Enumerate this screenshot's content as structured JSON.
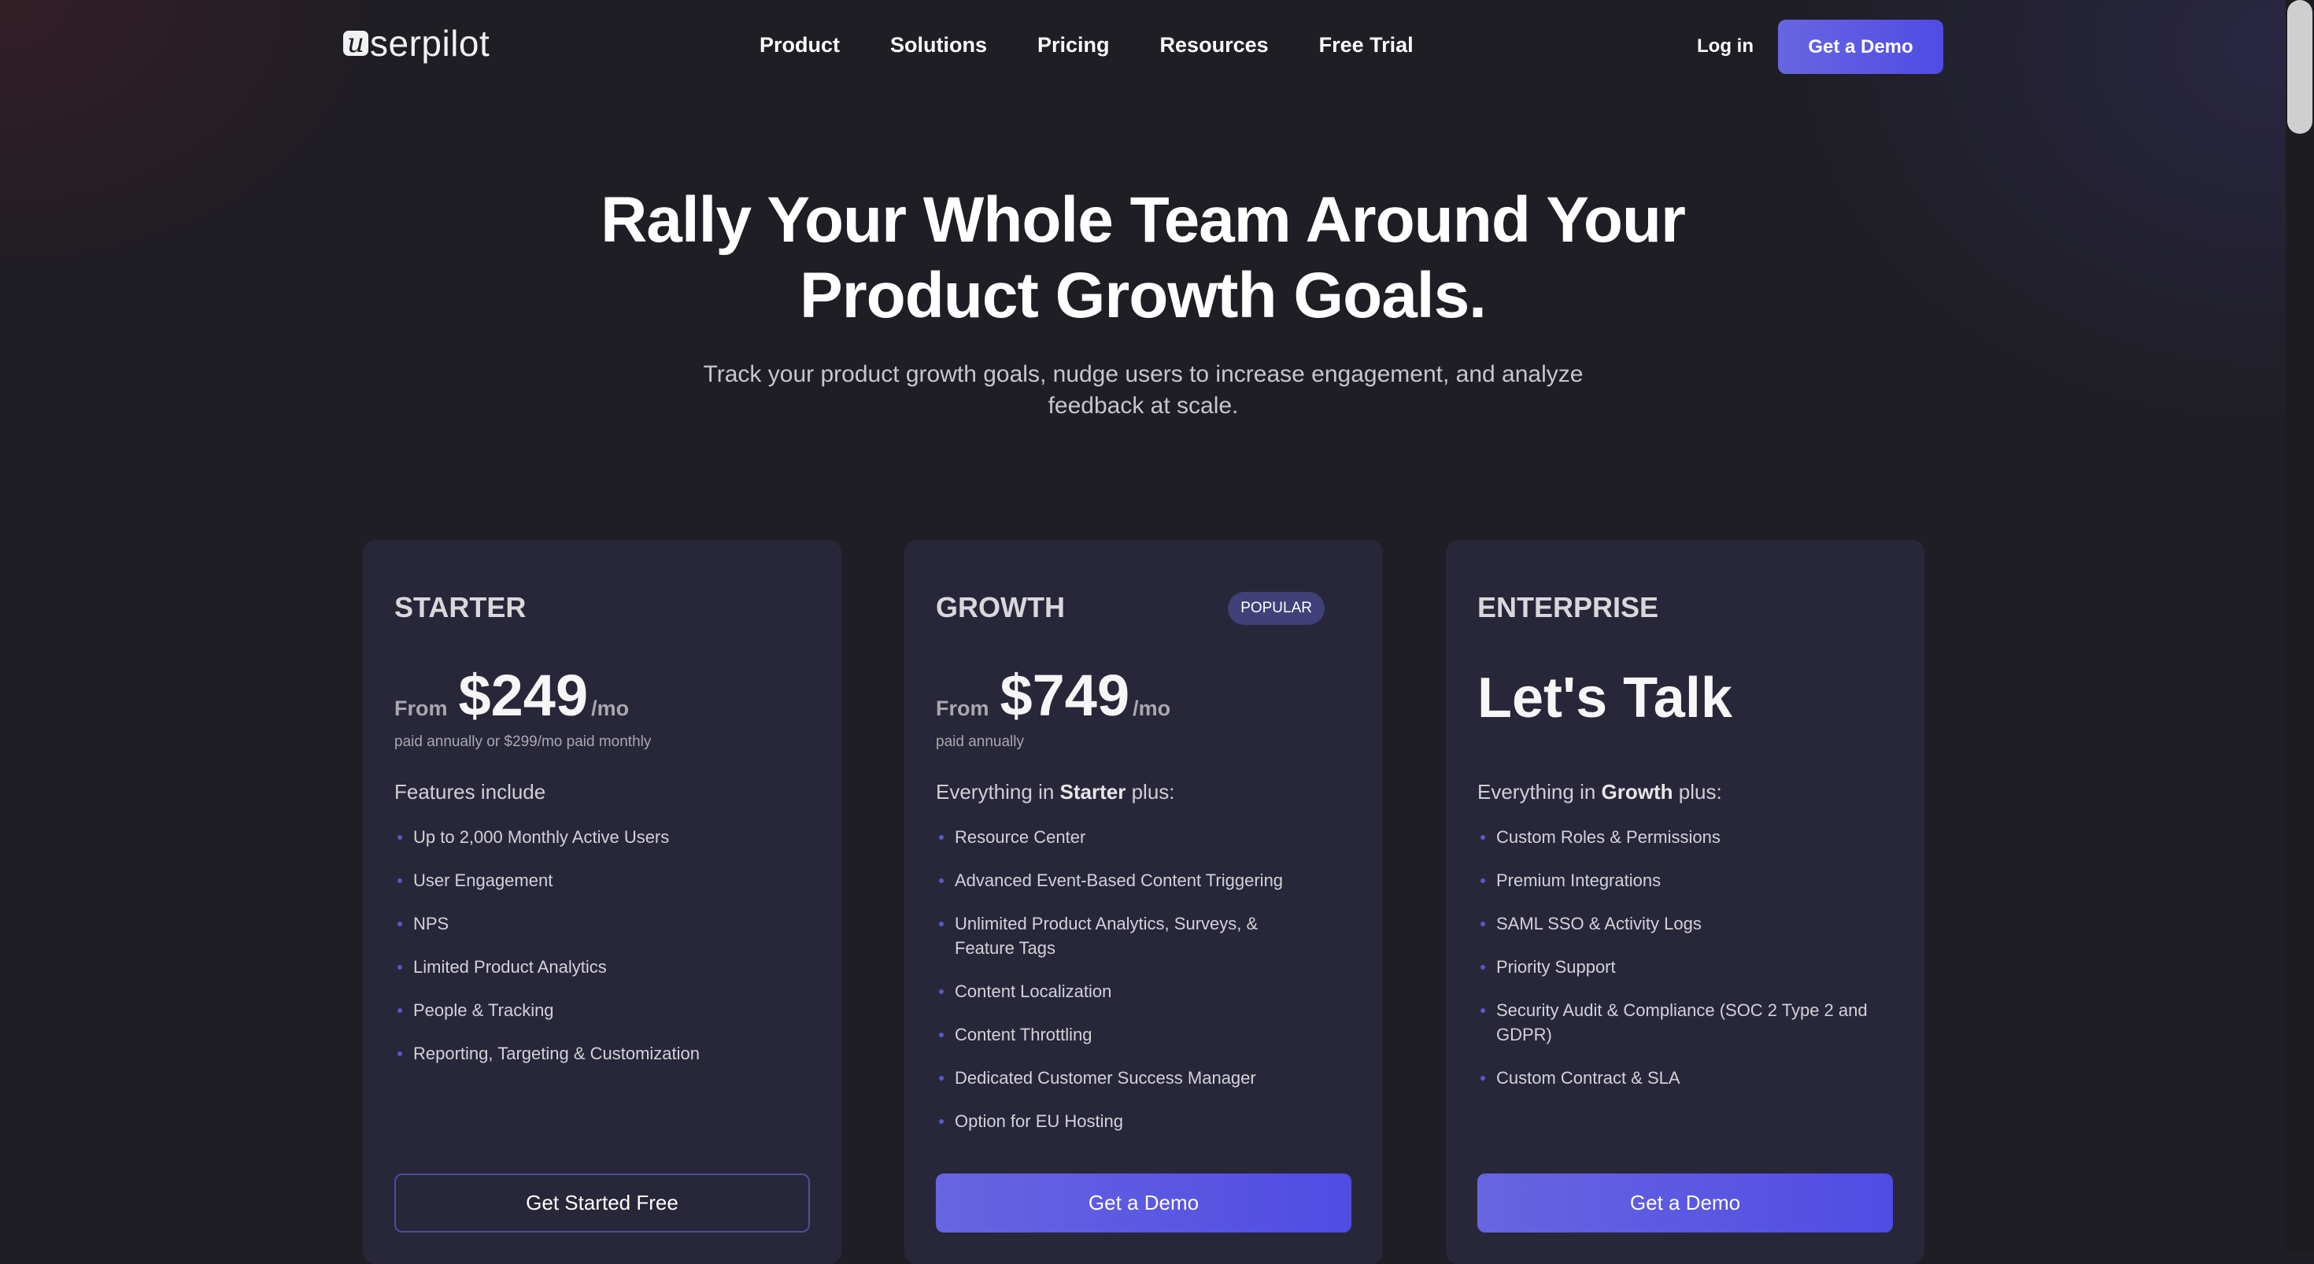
{
  "header": {
    "logo_mark": "u",
    "logo_text": "serpilot",
    "nav": [
      "Product",
      "Solutions",
      "Pricing",
      "Resources",
      "Free Trial"
    ],
    "login_label": "Log in",
    "demo_label": "Get a Demo"
  },
  "hero": {
    "title_line1": "Rally Your Whole Team Around Your",
    "title_line2": "Product Growth Goals.",
    "subtitle": "Track your product growth goals, nudge users to increase engagement, and analyze feedback at scale."
  },
  "plans": [
    {
      "name": "STARTER",
      "price_prefix": "From",
      "price": "$249",
      "price_suffix": "/mo",
      "price_note": "paid annually or $299/mo paid monthly",
      "features_intro": "Features include",
      "features": [
        "Up to 2,000 Monthly Active Users",
        "User Engagement",
        "NPS",
        "Limited Product Analytics",
        "People & Tracking",
        "Reporting, Targeting & Customization"
      ],
      "cta": "Get Started Free"
    },
    {
      "name": "GROWTH",
      "badge": "POPULAR",
      "price_prefix": "From",
      "price": "$749",
      "price_suffix": "/mo",
      "price_note": "paid annually",
      "features_intro_pre": "Everything in ",
      "features_intro_bold": "Starter",
      "features_intro_post": " plus:",
      "features": [
        "Resource Center",
        "Advanced Event-Based Content Triggering",
        "Unlimited Product Analytics, Surveys, & Feature Tags",
        "Content Localization",
        "Content Throttling",
        "Dedicated Customer Success Manager",
        "Option for EU Hosting"
      ],
      "cta": "Get a Demo"
    },
    {
      "name": "ENTERPRISE",
      "headline": "Let's Talk",
      "features_intro_pre": "Everything in ",
      "features_intro_bold": "Growth",
      "features_intro_post": " plus:",
      "features": [
        "Custom Roles & Permissions",
        "Premium Integrations",
        "SAML SSO & Activity Logs",
        "Priority Support",
        "Security Audit & Compliance (SOC 2 Type 2 and GDPR)",
        "Custom Contract & SLA"
      ],
      "cta": "Get a Demo"
    }
  ],
  "colors": {
    "background": "#1f1e24",
    "card": "#282739",
    "accent": "#5552e2",
    "badge": "#414078"
  }
}
